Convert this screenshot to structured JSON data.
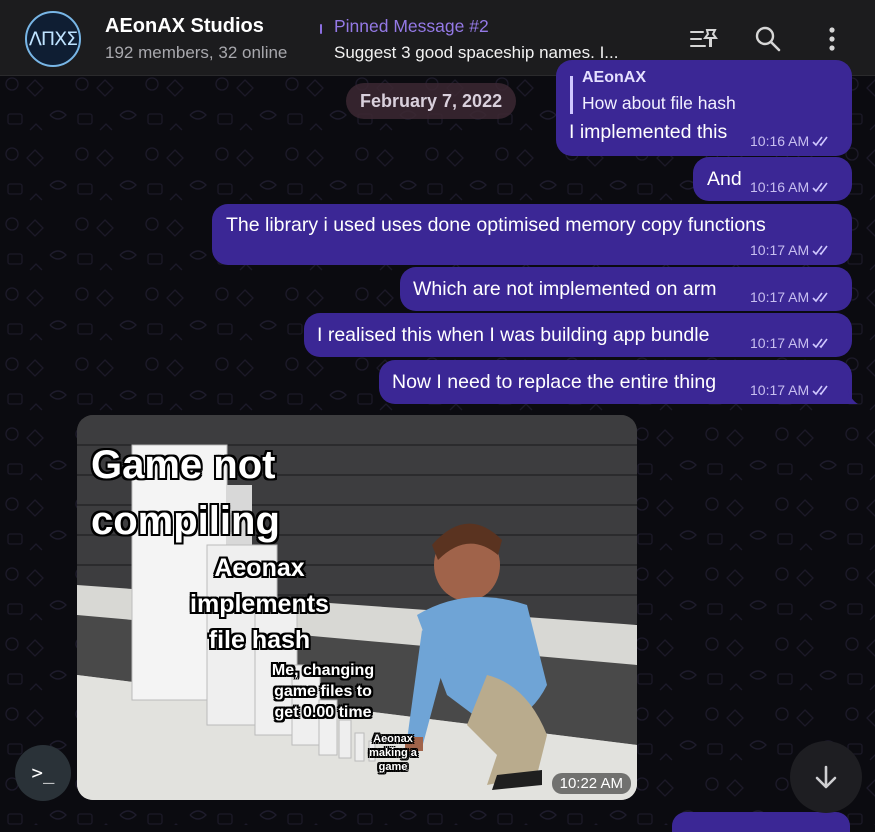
{
  "header": {
    "avatar_text": "ΛПΧΣ",
    "title": "AEonAX Studios",
    "subtitle": "192 members, 32 online",
    "pinned_title": "Pinned Message #2",
    "pinned_text": "Suggest 3 good spaceship names. I..."
  },
  "date_separator": "February 7, 2022",
  "messages": [
    {
      "reply_author": "AEonAX",
      "reply_text": "How about file hash",
      "text": "I implemented this",
      "time": "10:16 AM"
    },
    {
      "text": "And",
      "time": "10:16 AM"
    },
    {
      "text": "The library i used uses done optimised memory copy functions",
      "time": "10:17 AM"
    },
    {
      "text": "Which are not implemented on arm",
      "time": "10:17 AM"
    },
    {
      "text": "I realised this when I was building app bundle",
      "time": "10:17 AM"
    },
    {
      "text": "Now I need to replace the entire thing",
      "time": "10:17 AM"
    }
  ],
  "media": {
    "caption_1": "Game not compiling",
    "caption_2": "Aeonax implements file hash",
    "caption_3": "Me, changing game files to get 0.00 time",
    "caption_4": "Aeonax making a game",
    "time": "10:22 AM"
  },
  "bot_command_label": ">_",
  "colors": {
    "bubble": "#3b2795",
    "accent": "#9479e6",
    "header": "#1c1c1e"
  }
}
